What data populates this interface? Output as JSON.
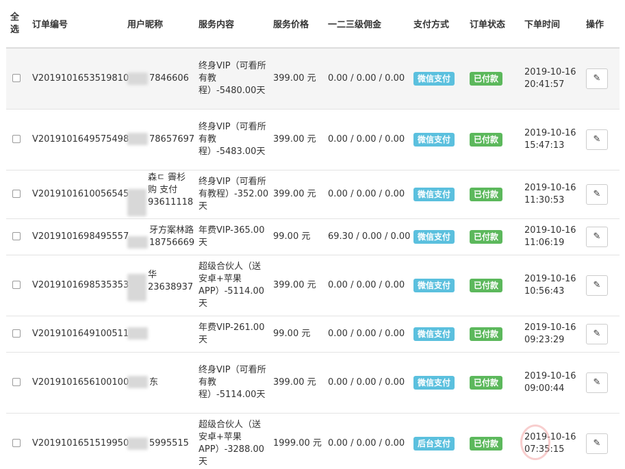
{
  "header": {
    "select_all": "全\n选",
    "order_no": "订单编号",
    "nickname": "用户昵称",
    "service": "服务内容",
    "price": "服务价格",
    "commission": "一二三级佣金",
    "pay_method": "支付方式",
    "status": "订单状态",
    "time": "下单时间",
    "action": "操作"
  },
  "rows": [
    {
      "order_no": "V2019101653519810",
      "nickname": "7846606",
      "service": "终身VIP（可看所有教程）-5480.00天",
      "price": "399.00 元",
      "commission": "0.00 / 0.00 / 0.00",
      "pay": "微信支付",
      "status": "已付款",
      "time": "2019-10-16\n20:41:57"
    },
    {
      "order_no": "V2019101649575498",
      "nickname": "78657697",
      "service": "终身VIP（可看所有教程）-5483.00天",
      "price": "399.00 元",
      "commission": "0.00 / 0.00 / 0.00",
      "pay": "微信支付",
      "status": "已付款",
      "time": "2019-10-16\n15:47:13"
    },
    {
      "order_no": "V2019101610056545",
      "nickname": "森ㄷ 霽杉\n购 支付\n93611118",
      "service": "终身VIP（可看所有教程）-352.00天",
      "price": "399.00 元",
      "commission": "0.00 / 0.00 / 0.00",
      "pay": "微信支付",
      "status": "已付款",
      "time": "2019-10-16\n11:30:53"
    },
    {
      "order_no": "V2019101698495557",
      "nickname": "牙方案林路\n18756669",
      "service": "年费VIP-365.00天",
      "price": "99.00 元",
      "commission": "69.30 / 0.00 / 0.00",
      "pay": "微信支付",
      "status": "已付款",
      "time": "2019-10-16\n11:06:19"
    },
    {
      "order_no": "V2019101698535353",
      "nickname": "华\n23638937",
      "service": "超级合伙人（送安卓+苹果APP）-5114.00天",
      "price": "399.00 元",
      "commission": "0.00 / 0.00 / 0.00",
      "pay": "微信支付",
      "status": "已付款",
      "time": "2019-10-16\n10:56:43"
    },
    {
      "order_no": "V2019101649100511",
      "nickname": "",
      "service": "年费VIP-261.00天",
      "price": "99.00 元",
      "commission": "0.00 / 0.00 / 0.00",
      "pay": "微信支付",
      "status": "已付款",
      "time": "2019-10-16\n09:23:29"
    },
    {
      "order_no": "V2019101656100100",
      "nickname": "东",
      "service": "终身VIP（可看所有教程）-5114.00天",
      "price": "399.00 元",
      "commission": "0.00 / 0.00 / 0.00",
      "pay": "微信支付",
      "status": "已付款",
      "time": "2019-10-16\n09:00:44"
    },
    {
      "order_no": "V2019101651519950",
      "nickname": "5995515",
      "service": "超级合伙人（送安卓+苹果APP）-3288.00天",
      "price": "1999.00 元",
      "commission": "0.00 / 0.00 / 0.00",
      "pay": "后台支付",
      "status": "已付款",
      "time": "2019-10-16\n07:35:15"
    }
  ],
  "colors": {
    "pay_label": "#5bc0de",
    "status_label": "#5cb85c",
    "hover_row": "#f5f5f5"
  },
  "icons": {
    "edit": "pencil-icon"
  }
}
